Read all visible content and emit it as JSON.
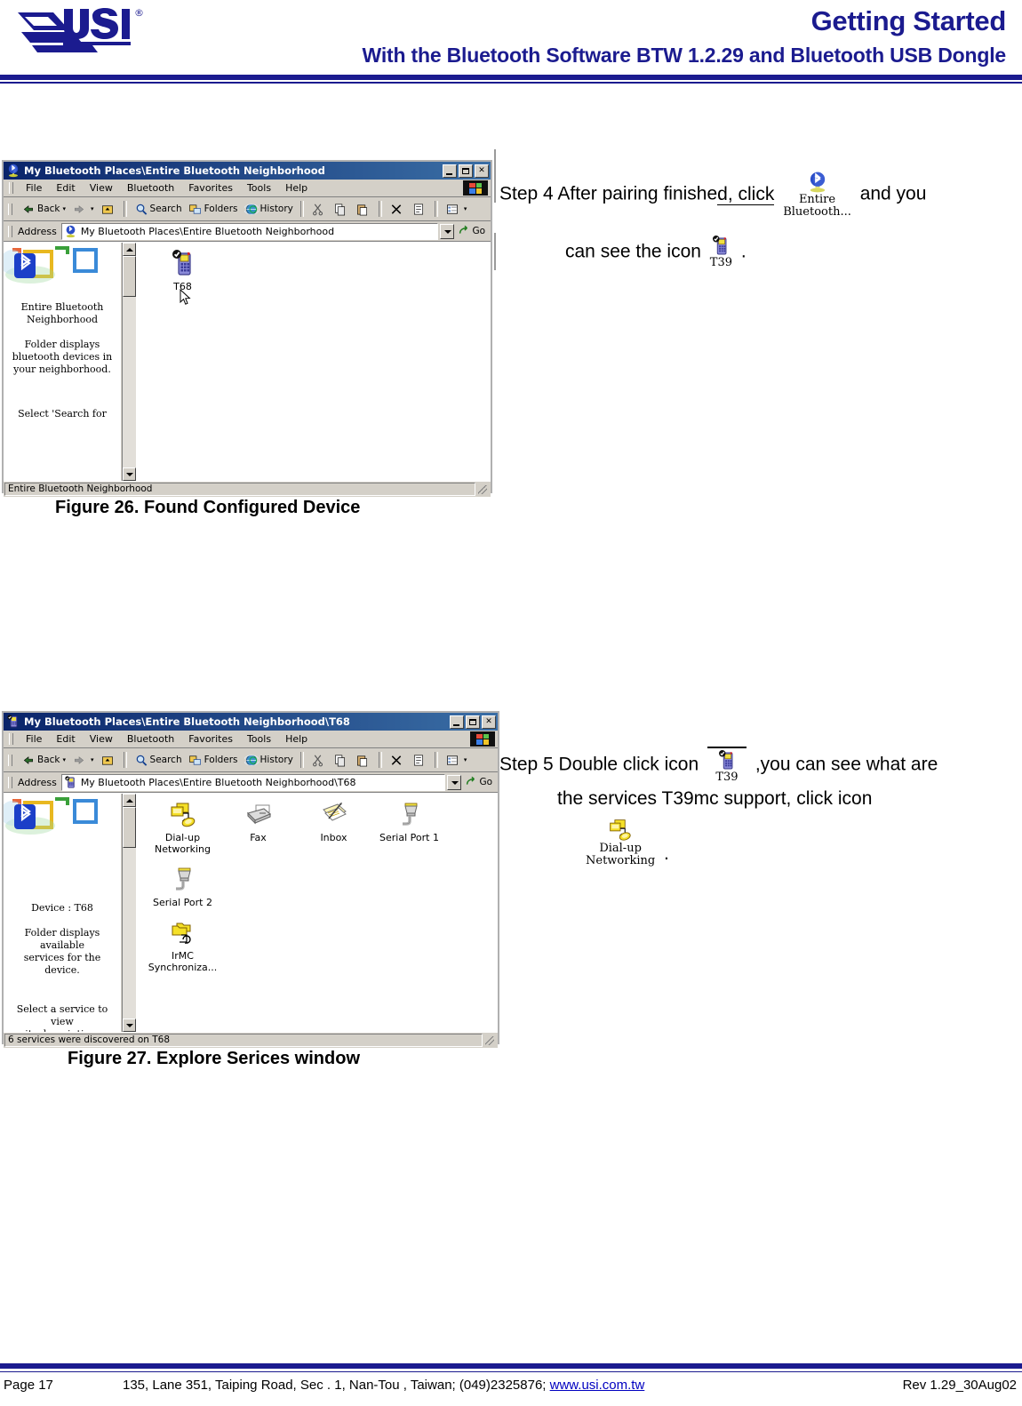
{
  "header": {
    "logo_alt": "USI",
    "title": "Getting Started",
    "subtitle": "With the Bluetooth Software BTW 1.2.29 and Bluetooth USB Dongle"
  },
  "footer": {
    "page": "Page 17",
    "address": "135, Lane 351, Taiping Road, Sec . 1, Nan-Tou , Taiwan; (049)2325876; ",
    "link": "www.usi.com.tw",
    "revision": "Rev 1.29_30Aug02"
  },
  "window1": {
    "title": "My Bluetooth Places\\Entire Bluetooth Neighborhood",
    "title_icon": "bluetooth-globe-icon",
    "buttons": {
      "minimize": "_",
      "maximize": "□",
      "close": "✕"
    },
    "menu": [
      "File",
      "Edit",
      "View",
      "Bluetooth",
      "Favorites",
      "Tools",
      "Help"
    ],
    "toolbar": {
      "back": "Back",
      "forward": "",
      "up": "",
      "search": "Search",
      "folders": "Folders",
      "history": "History"
    },
    "address": {
      "label": "Address",
      "value": "My Bluetooth Places\\Entire Bluetooth Neighborhood",
      "go": "Go"
    },
    "sidebar": {
      "heading": "Entire Bluetooth\nNeighborhood",
      "desc": "Folder displays\nbluetooth devices in\nyour neighborhood.",
      "hint": "Select 'Search for"
    },
    "items": [
      {
        "label": "T68",
        "icon": "mobile-phone-paired-icon"
      }
    ],
    "statusbar": "Entire Bluetooth Neighborhood"
  },
  "figure26": {
    "caption": "Figure 26. Found Configured Device"
  },
  "window2": {
    "title": "My Bluetooth Places\\Entire Bluetooth Neighborhood\\T68",
    "title_icon": "mobile-phone-icon",
    "buttons": {
      "minimize": "_",
      "maximize": "□",
      "close": "✕"
    },
    "menu": [
      "File",
      "Edit",
      "View",
      "Bluetooth",
      "Favorites",
      "Tools",
      "Help"
    ],
    "toolbar": {
      "back": "Back",
      "search": "Search",
      "folders": "Folders",
      "history": "History"
    },
    "address": {
      "label": "Address",
      "value": "My Bluetooth Places\\Entire Bluetooth Neighborhood\\T68",
      "go": "Go"
    },
    "sidebar": {
      "heading": "Device : T68",
      "desc": "Folder displays available\nservices for the device.",
      "hint": "Select a service to view\nits description."
    },
    "items": [
      {
        "label": "Dial-up\nNetworking",
        "icon": "dialup-networking-icon"
      },
      {
        "label": "Fax",
        "icon": "fax-icon"
      },
      {
        "label": "Inbox",
        "icon": "inbox-icon"
      },
      {
        "label": "Serial Port 1",
        "icon": "serial-port-icon"
      },
      {
        "label": "Serial Port 2",
        "icon": "serial-port-icon"
      },
      {
        "label": "IrMC\nSynchroniza...",
        "icon": "irmc-sync-icon"
      }
    ],
    "statusbar": "6 services were discovered on T68"
  },
  "figure27": {
    "caption": "Figure 27. Explore Serices window"
  },
  "step4": {
    "line1_a": "Step 4 After pairing finished, click",
    "underlined": "d, click",
    "icon_caption": "Entire\nBluetooth...",
    "icon_name": "entire-bluetooth-globe-icon",
    "line1_b": "and you",
    "line2_a": "can see the icon",
    "icon2_caption": "T39",
    "icon2_name": "t39-phone-icon",
    "line2_b": "."
  },
  "step5": {
    "line1_a": "Step 5 Double click icon",
    "icon_caption": "T39",
    "icon_name": "t39-phone-icon",
    "line1_b": ",you can see what are",
    "line2": "the services T39mc support, click icon",
    "icon2_caption": "Dial-up\nNetworking",
    "icon2_name": "dialup-networking-icon",
    "line3": "."
  },
  "colors": {
    "brand_blue": "#1b1b8f",
    "title_bar_start": "#0a246a",
    "title_bar_end": "#3a6ea5",
    "window_face": "#d4d0c8",
    "link": "#0000c0"
  }
}
